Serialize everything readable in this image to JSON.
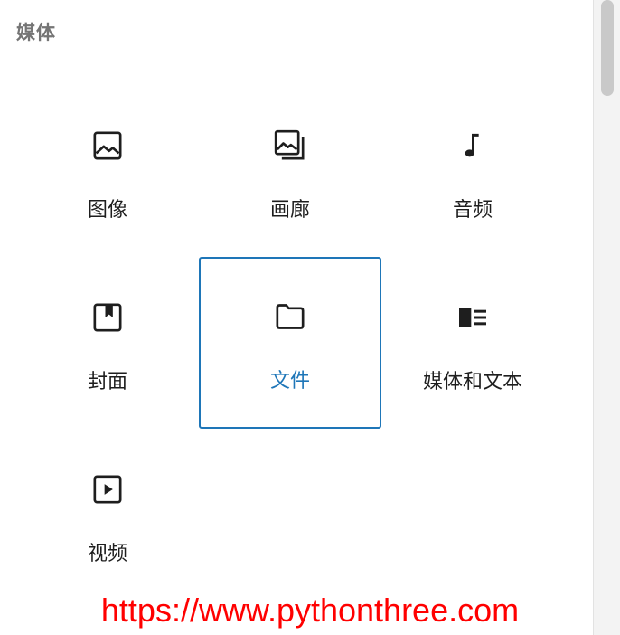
{
  "section": {
    "title": "媒体"
  },
  "blocks": [
    {
      "label": "图像",
      "icon": "image-icon"
    },
    {
      "label": "画廊",
      "icon": "gallery-icon"
    },
    {
      "label": "音频",
      "icon": "audio-icon"
    },
    {
      "label": "封面",
      "icon": "cover-icon"
    },
    {
      "label": "文件",
      "icon": "file-icon",
      "selected": true
    },
    {
      "label": "媒体和文本",
      "icon": "media-text-icon"
    },
    {
      "label": "视频",
      "icon": "video-icon"
    }
  ],
  "colors": {
    "accent": "#1e76b8",
    "title": "#757575",
    "text": "#1e1e1e",
    "watermark": "#ff0000"
  },
  "watermark": {
    "text": "https://www.pythonthree.com"
  }
}
